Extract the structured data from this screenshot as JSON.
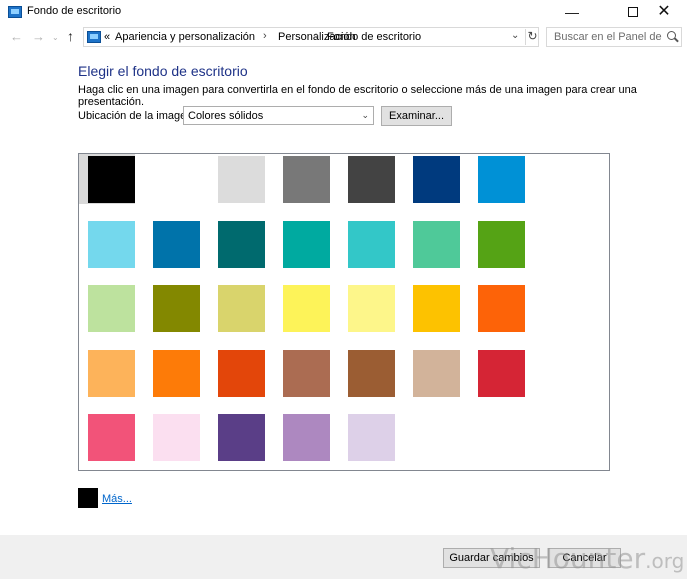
{
  "window": {
    "title": "Fondo de escritorio",
    "minimize": "—",
    "close": "✕"
  },
  "nav": {
    "back": "←",
    "forward": "→",
    "recent": "⌄",
    "up": "↑",
    "overflow": "«",
    "breadcrumbs": [
      "Apariencia y personalización",
      "Personalización",
      "Fondo de escritorio"
    ],
    "separator": "›",
    "refresh": "↻",
    "search_placeholder": "Buscar en el Panel de c..."
  },
  "main": {
    "heading": "Elegir el fondo de escritorio",
    "description": "Haga clic en una imagen para convertirla en el fondo de escritorio o seleccione más de una imagen para crear una presentación.",
    "location_label": "Ubicación de la imagen:",
    "location_value": "Colores sólidos",
    "location_chevron": "⌄",
    "browse_label": "Examinar..."
  },
  "swatches": {
    "selected_index": 0,
    "colors": [
      "#000000",
      "#ffffff",
      "#dcdcdc",
      "#787878",
      "#434343",
      "#003a7e",
      "#0091d6",
      "#74d8ed",
      "#0073aa",
      "#006a6e",
      "#00aaa0",
      "#33c7c8",
      "#4fc999",
      "#55a315",
      "#bde29e",
      "#838800",
      "#d9d46c",
      "#fdf359",
      "#fdf68a",
      "#fdc200",
      "#fd6308",
      "#fdb35a",
      "#fd7b08",
      "#e3460a",
      "#ab6c52",
      "#9b5d33",
      "#d2b39a",
      "#d52535",
      "#f25379",
      "#fbdff0",
      "#5a3e87",
      "#ad88c0",
      "#ddd0e8"
    ]
  },
  "more": {
    "label": "Más...",
    "color": "#000000"
  },
  "footer": {
    "save_label": "Guardar cambios",
    "cancel_label": "Cancelar"
  },
  "watermark": "VicHounter.org"
}
